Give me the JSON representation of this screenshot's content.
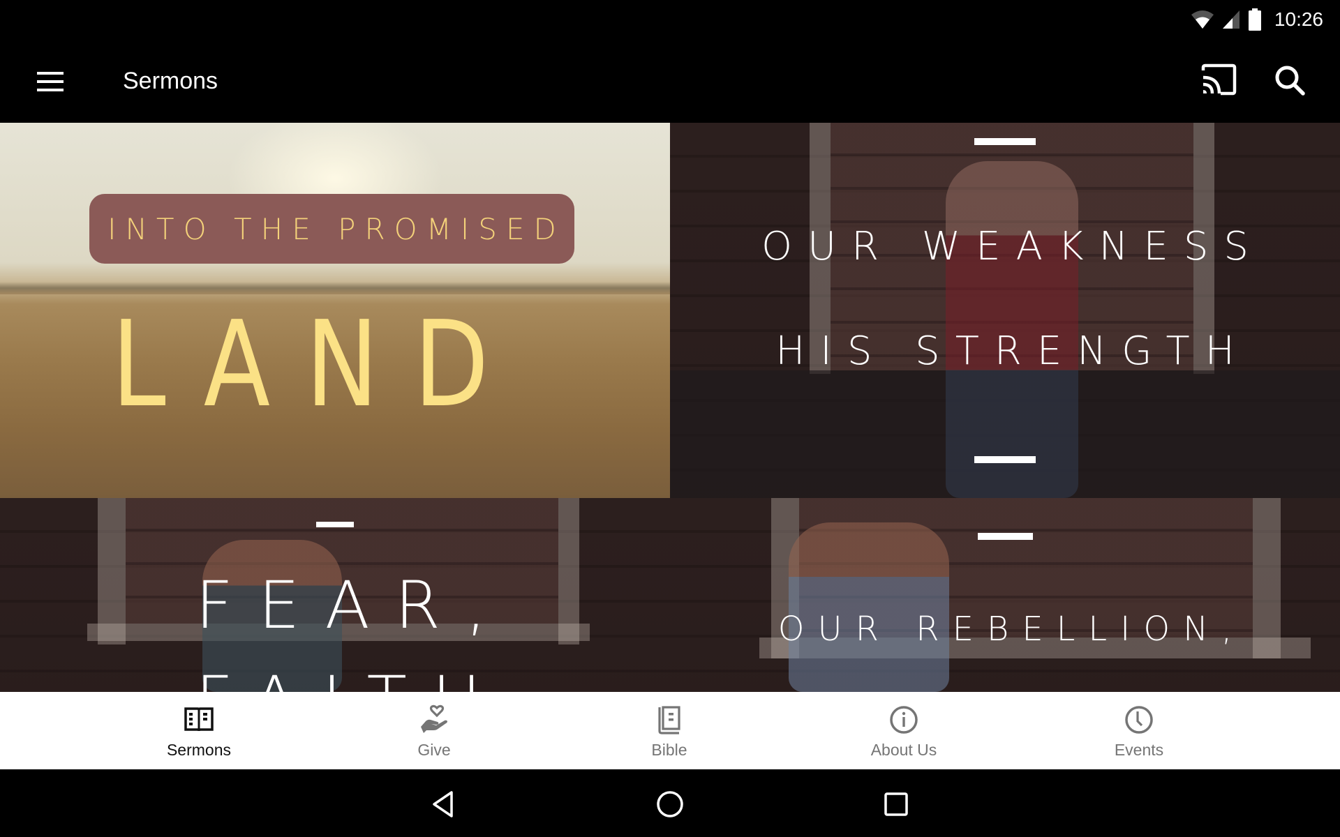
{
  "status_bar": {
    "time": "10:26",
    "icons": [
      "wifi-icon",
      "cell-signal-icon",
      "battery-icon"
    ]
  },
  "app_bar": {
    "menu_icon": "hamburger-menu-icon",
    "title": "Sermons",
    "actions": [
      {
        "name": "cast",
        "icon": "cast-icon"
      },
      {
        "name": "search",
        "icon": "search-icon"
      }
    ]
  },
  "sermons": [
    {
      "series_label": "INTO THE PROMISED",
      "title": "LAND",
      "label_color": "#f4d27a",
      "title_color": "#fbe186",
      "banner_color": "#8b5a57"
    },
    {
      "title_line1": "OUR WEAKNESS",
      "title_line2": "HIS STRENGTH",
      "text_color": "#ffffff"
    },
    {
      "title_line1": "FEAR,",
      "title_line2": "FAITH",
      "text_color": "#ffffff"
    },
    {
      "title_line1": "OUR REBELLION,",
      "text_color": "#ffffff"
    }
  ],
  "bottom_nav": {
    "active_index": 0,
    "items": [
      {
        "label": "Sermons",
        "icon": "open-book-icon"
      },
      {
        "label": "Give",
        "icon": "hand-heart-icon"
      },
      {
        "label": "Bible",
        "icon": "bible-icon"
      },
      {
        "label": "About Us",
        "icon": "info-icon"
      },
      {
        "label": "Events",
        "icon": "clock-icon"
      }
    ],
    "active_color": "#111111",
    "inactive_color": "#757575"
  },
  "system_nav": {
    "buttons": [
      "back",
      "home",
      "recents"
    ]
  }
}
